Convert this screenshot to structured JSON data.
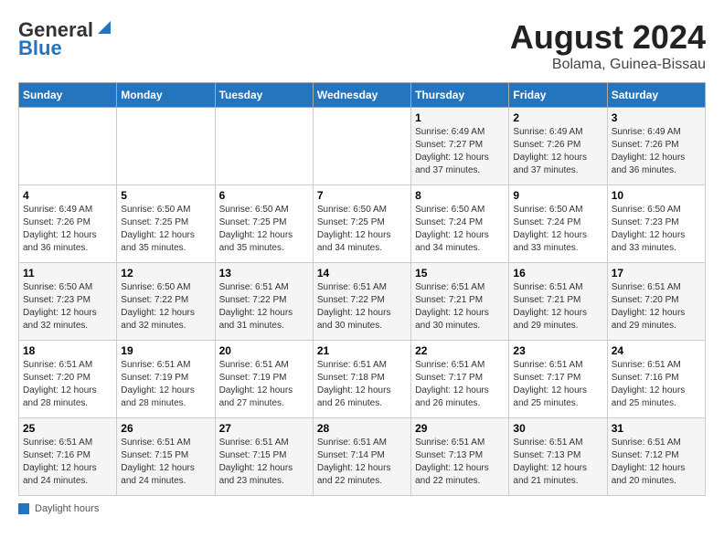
{
  "header": {
    "logo_general": "General",
    "logo_blue": "Blue",
    "title": "August 2024",
    "subtitle": "Bolama, Guinea-Bissau"
  },
  "weekdays": [
    "Sunday",
    "Monday",
    "Tuesday",
    "Wednesday",
    "Thursday",
    "Friday",
    "Saturday"
  ],
  "weeks": [
    [
      {
        "day": "",
        "sunrise": "",
        "sunset": "",
        "daylight": ""
      },
      {
        "day": "",
        "sunrise": "",
        "sunset": "",
        "daylight": ""
      },
      {
        "day": "",
        "sunrise": "",
        "sunset": "",
        "daylight": ""
      },
      {
        "day": "",
        "sunrise": "",
        "sunset": "",
        "daylight": ""
      },
      {
        "day": "1",
        "sunrise": "Sunrise: 6:49 AM",
        "sunset": "Sunset: 7:27 PM",
        "daylight": "Daylight: 12 hours and 37 minutes."
      },
      {
        "day": "2",
        "sunrise": "Sunrise: 6:49 AM",
        "sunset": "Sunset: 7:26 PM",
        "daylight": "Daylight: 12 hours and 37 minutes."
      },
      {
        "day": "3",
        "sunrise": "Sunrise: 6:49 AM",
        "sunset": "Sunset: 7:26 PM",
        "daylight": "Daylight: 12 hours and 36 minutes."
      }
    ],
    [
      {
        "day": "4",
        "sunrise": "Sunrise: 6:49 AM",
        "sunset": "Sunset: 7:26 PM",
        "daylight": "Daylight: 12 hours and 36 minutes."
      },
      {
        "day": "5",
        "sunrise": "Sunrise: 6:50 AM",
        "sunset": "Sunset: 7:25 PM",
        "daylight": "Daylight: 12 hours and 35 minutes."
      },
      {
        "day": "6",
        "sunrise": "Sunrise: 6:50 AM",
        "sunset": "Sunset: 7:25 PM",
        "daylight": "Daylight: 12 hours and 35 minutes."
      },
      {
        "day": "7",
        "sunrise": "Sunrise: 6:50 AM",
        "sunset": "Sunset: 7:25 PM",
        "daylight": "Daylight: 12 hours and 34 minutes."
      },
      {
        "day": "8",
        "sunrise": "Sunrise: 6:50 AM",
        "sunset": "Sunset: 7:24 PM",
        "daylight": "Daylight: 12 hours and 34 minutes."
      },
      {
        "day": "9",
        "sunrise": "Sunrise: 6:50 AM",
        "sunset": "Sunset: 7:24 PM",
        "daylight": "Daylight: 12 hours and 33 minutes."
      },
      {
        "day": "10",
        "sunrise": "Sunrise: 6:50 AM",
        "sunset": "Sunset: 7:23 PM",
        "daylight": "Daylight: 12 hours and 33 minutes."
      }
    ],
    [
      {
        "day": "11",
        "sunrise": "Sunrise: 6:50 AM",
        "sunset": "Sunset: 7:23 PM",
        "daylight": "Daylight: 12 hours and 32 minutes."
      },
      {
        "day": "12",
        "sunrise": "Sunrise: 6:50 AM",
        "sunset": "Sunset: 7:22 PM",
        "daylight": "Daylight: 12 hours and 32 minutes."
      },
      {
        "day": "13",
        "sunrise": "Sunrise: 6:51 AM",
        "sunset": "Sunset: 7:22 PM",
        "daylight": "Daylight: 12 hours and 31 minutes."
      },
      {
        "day": "14",
        "sunrise": "Sunrise: 6:51 AM",
        "sunset": "Sunset: 7:22 PM",
        "daylight": "Daylight: 12 hours and 30 minutes."
      },
      {
        "day": "15",
        "sunrise": "Sunrise: 6:51 AM",
        "sunset": "Sunset: 7:21 PM",
        "daylight": "Daylight: 12 hours and 30 minutes."
      },
      {
        "day": "16",
        "sunrise": "Sunrise: 6:51 AM",
        "sunset": "Sunset: 7:21 PM",
        "daylight": "Daylight: 12 hours and 29 minutes."
      },
      {
        "day": "17",
        "sunrise": "Sunrise: 6:51 AM",
        "sunset": "Sunset: 7:20 PM",
        "daylight": "Daylight: 12 hours and 29 minutes."
      }
    ],
    [
      {
        "day": "18",
        "sunrise": "Sunrise: 6:51 AM",
        "sunset": "Sunset: 7:20 PM",
        "daylight": "Daylight: 12 hours and 28 minutes."
      },
      {
        "day": "19",
        "sunrise": "Sunrise: 6:51 AM",
        "sunset": "Sunset: 7:19 PM",
        "daylight": "Daylight: 12 hours and 28 minutes."
      },
      {
        "day": "20",
        "sunrise": "Sunrise: 6:51 AM",
        "sunset": "Sunset: 7:19 PM",
        "daylight": "Daylight: 12 hours and 27 minutes."
      },
      {
        "day": "21",
        "sunrise": "Sunrise: 6:51 AM",
        "sunset": "Sunset: 7:18 PM",
        "daylight": "Daylight: 12 hours and 26 minutes."
      },
      {
        "day": "22",
        "sunrise": "Sunrise: 6:51 AM",
        "sunset": "Sunset: 7:17 PM",
        "daylight": "Daylight: 12 hours and 26 minutes."
      },
      {
        "day": "23",
        "sunrise": "Sunrise: 6:51 AM",
        "sunset": "Sunset: 7:17 PM",
        "daylight": "Daylight: 12 hours and 25 minutes."
      },
      {
        "day": "24",
        "sunrise": "Sunrise: 6:51 AM",
        "sunset": "Sunset: 7:16 PM",
        "daylight": "Daylight: 12 hours and 25 minutes."
      }
    ],
    [
      {
        "day": "25",
        "sunrise": "Sunrise: 6:51 AM",
        "sunset": "Sunset: 7:16 PM",
        "daylight": "Daylight: 12 hours and 24 minutes."
      },
      {
        "day": "26",
        "sunrise": "Sunrise: 6:51 AM",
        "sunset": "Sunset: 7:15 PM",
        "daylight": "Daylight: 12 hours and 24 minutes."
      },
      {
        "day": "27",
        "sunrise": "Sunrise: 6:51 AM",
        "sunset": "Sunset: 7:15 PM",
        "daylight": "Daylight: 12 hours and 23 minutes."
      },
      {
        "day": "28",
        "sunrise": "Sunrise: 6:51 AM",
        "sunset": "Sunset: 7:14 PM",
        "daylight": "Daylight: 12 hours and 22 minutes."
      },
      {
        "day": "29",
        "sunrise": "Sunrise: 6:51 AM",
        "sunset": "Sunset: 7:13 PM",
        "daylight": "Daylight: 12 hours and 22 minutes."
      },
      {
        "day": "30",
        "sunrise": "Sunrise: 6:51 AM",
        "sunset": "Sunset: 7:13 PM",
        "daylight": "Daylight: 12 hours and 21 minutes."
      },
      {
        "day": "31",
        "sunrise": "Sunrise: 6:51 AM",
        "sunset": "Sunset: 7:12 PM",
        "daylight": "Daylight: 12 hours and 20 minutes."
      }
    ]
  ],
  "footer": {
    "label": "Daylight hours"
  }
}
